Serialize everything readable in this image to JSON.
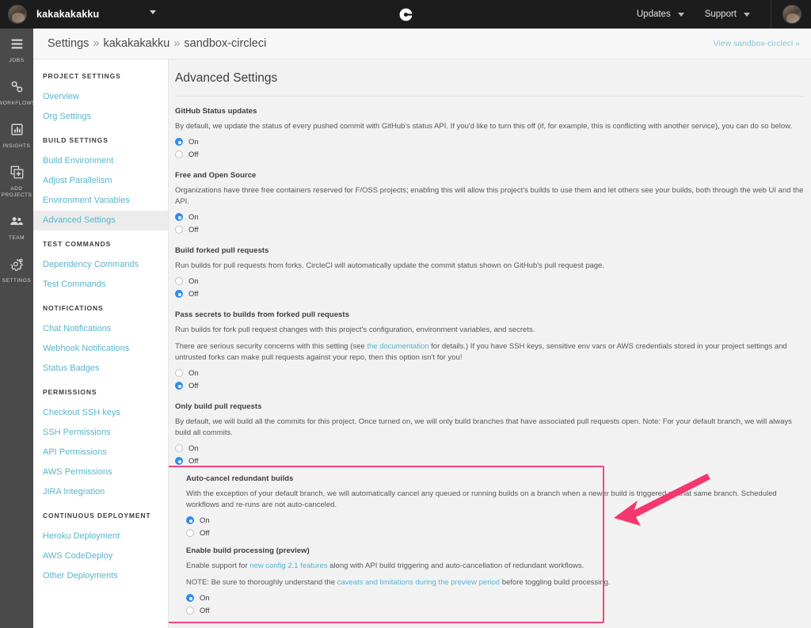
{
  "topbar": {
    "org_name": "kakakakakku",
    "org_caret_icon": "chevron-down-icon",
    "logo_icon": "circleci-logo-icon",
    "updates_label": "Updates",
    "support_label": "Support",
    "avatar_icon": "user-avatar"
  },
  "rail": {
    "items": [
      {
        "label": "JOBS",
        "icon": "list-icon"
      },
      {
        "label": "WORKFLOWS",
        "icon": "workflows-icon"
      },
      {
        "label": "INSIGHTS",
        "icon": "bar-chart-icon"
      },
      {
        "label": "ADD PROJECTS",
        "icon": "add-project-icon"
      },
      {
        "label": "TEAM",
        "icon": "people-icon"
      },
      {
        "label": "SETTINGS",
        "icon": "gear-icon"
      }
    ]
  },
  "breadcrumb": {
    "items": [
      "Settings",
      "kakakakakku",
      "sandbox-circleci"
    ],
    "separator": "»",
    "view_link": "View sandbox-circleci »"
  },
  "nav": {
    "groups": [
      {
        "header": "PROJECT SETTINGS",
        "items": [
          {
            "label": "Overview",
            "active": false
          },
          {
            "label": "Org Settings",
            "active": false
          }
        ]
      },
      {
        "header": "BUILD SETTINGS",
        "items": [
          {
            "label": "Build Environment",
            "active": false
          },
          {
            "label": "Adjust Parallelism",
            "active": false
          },
          {
            "label": "Environment Variables",
            "active": false
          },
          {
            "label": "Advanced Settings",
            "active": true
          }
        ]
      },
      {
        "header": "TEST COMMANDS",
        "items": [
          {
            "label": "Dependency Commands",
            "active": false
          },
          {
            "label": "Test Commands",
            "active": false
          }
        ]
      },
      {
        "header": "NOTIFICATIONS",
        "items": [
          {
            "label": "Chat Notifications",
            "active": false
          },
          {
            "label": "Webhook Notifications",
            "active": false
          },
          {
            "label": "Status Badges",
            "active": false
          }
        ]
      },
      {
        "header": "PERMISSIONS",
        "items": [
          {
            "label": "Checkout SSH keys",
            "active": false
          },
          {
            "label": "SSH Permissions",
            "active": false
          },
          {
            "label": "API Permissions",
            "active": false
          },
          {
            "label": "AWS Permissions",
            "active": false
          },
          {
            "label": "JIRA Integration",
            "active": false
          }
        ]
      },
      {
        "header": "CONTINUOUS DEPLOYMENT",
        "items": [
          {
            "label": "Heroku Deployment",
            "active": false
          },
          {
            "label": "AWS CodeDeploy",
            "active": false
          },
          {
            "label": "Other Deployments",
            "active": false
          }
        ]
      }
    ]
  },
  "main": {
    "title": "Advanced Settings",
    "on_label": "On",
    "off_label": "Off",
    "sections": [
      {
        "heading": "GitHub Status updates",
        "paragraphs": [
          [
            {
              "t": "By default, we update the status of every pushed commit with GitHub's status API. If you'd like to turn this off (if, for example, this is conflicting with another service), you can do so below."
            }
          ]
        ],
        "selected": "on"
      },
      {
        "heading": "Free and Open Source",
        "paragraphs": [
          [
            {
              "t": "Organizations have three free containers reserved for F/OSS projects; enabling this will allow this project's builds to use them and let others see your builds, both through the web UI and the API."
            }
          ]
        ],
        "selected": "on"
      },
      {
        "heading": "Build forked pull requests",
        "paragraphs": [
          [
            {
              "t": "Run builds for pull requests from forks. CircleCI will automatically update the commit status shown on GitHub's pull request page."
            }
          ]
        ],
        "selected": "off"
      },
      {
        "heading": "Pass secrets to builds from forked pull requests",
        "paragraphs": [
          [
            {
              "t": "Run builds for fork pull request changes with this project's configuration, environment variables, and secrets."
            }
          ],
          [
            {
              "t": "There are serious security concerns with this setting (see "
            },
            {
              "t": "the documentation",
              "link": true
            },
            {
              "t": " for details.) If you have SSH keys, sensitive env vars or AWS credentials stored in your project settings and untrusted forks can make pull requests against your repo, then this option isn't for you!"
            }
          ]
        ],
        "selected": "off"
      },
      {
        "heading": "Only build pull requests",
        "paragraphs": [
          [
            {
              "t": "By default, we will build all the commits for this project. Once turned on, we will only build branches that have associated pull requests open. Note: For your default branch, we will always build all commits."
            }
          ]
        ],
        "selected": "off"
      },
      {
        "heading": "Auto-cancel redundant builds",
        "highlighted": true,
        "paragraphs": [
          [
            {
              "t": "With the exception of your default branch, we will automatically cancel any queued or running builds on a branch when a newer build is triggered on that same branch. Scheduled workflows and re-runs are not auto-canceled."
            }
          ]
        ],
        "selected": "on"
      },
      {
        "heading": "Enable build processing (preview)",
        "highlighted": true,
        "paragraphs": [
          [
            {
              "t": "Enable support for "
            },
            {
              "t": "new config 2.1 features",
              "link": true
            },
            {
              "t": " along with API build triggering and auto-cancellation of redundant workflows."
            }
          ],
          [
            {
              "t": "NOTE: Be sure to thoroughly understand the "
            },
            {
              "t": "caveats and limitations during the preview period",
              "link": true
            },
            {
              "t": " before toggling build processing."
            }
          ]
        ],
        "selected": "on"
      }
    ]
  },
  "annotations": {
    "highlight_color": "#f4477c",
    "arrow_color": "#f4376e",
    "arrow_name": "pink-arrow-annotation",
    "box_name": "pink-highlight-box"
  },
  "colors": {
    "link": "#5ab4cc",
    "radio_selected": "#2d8cf0",
    "topbar_bg": "#1c1c1c",
    "rail_bg": "#4a4a4a"
  }
}
